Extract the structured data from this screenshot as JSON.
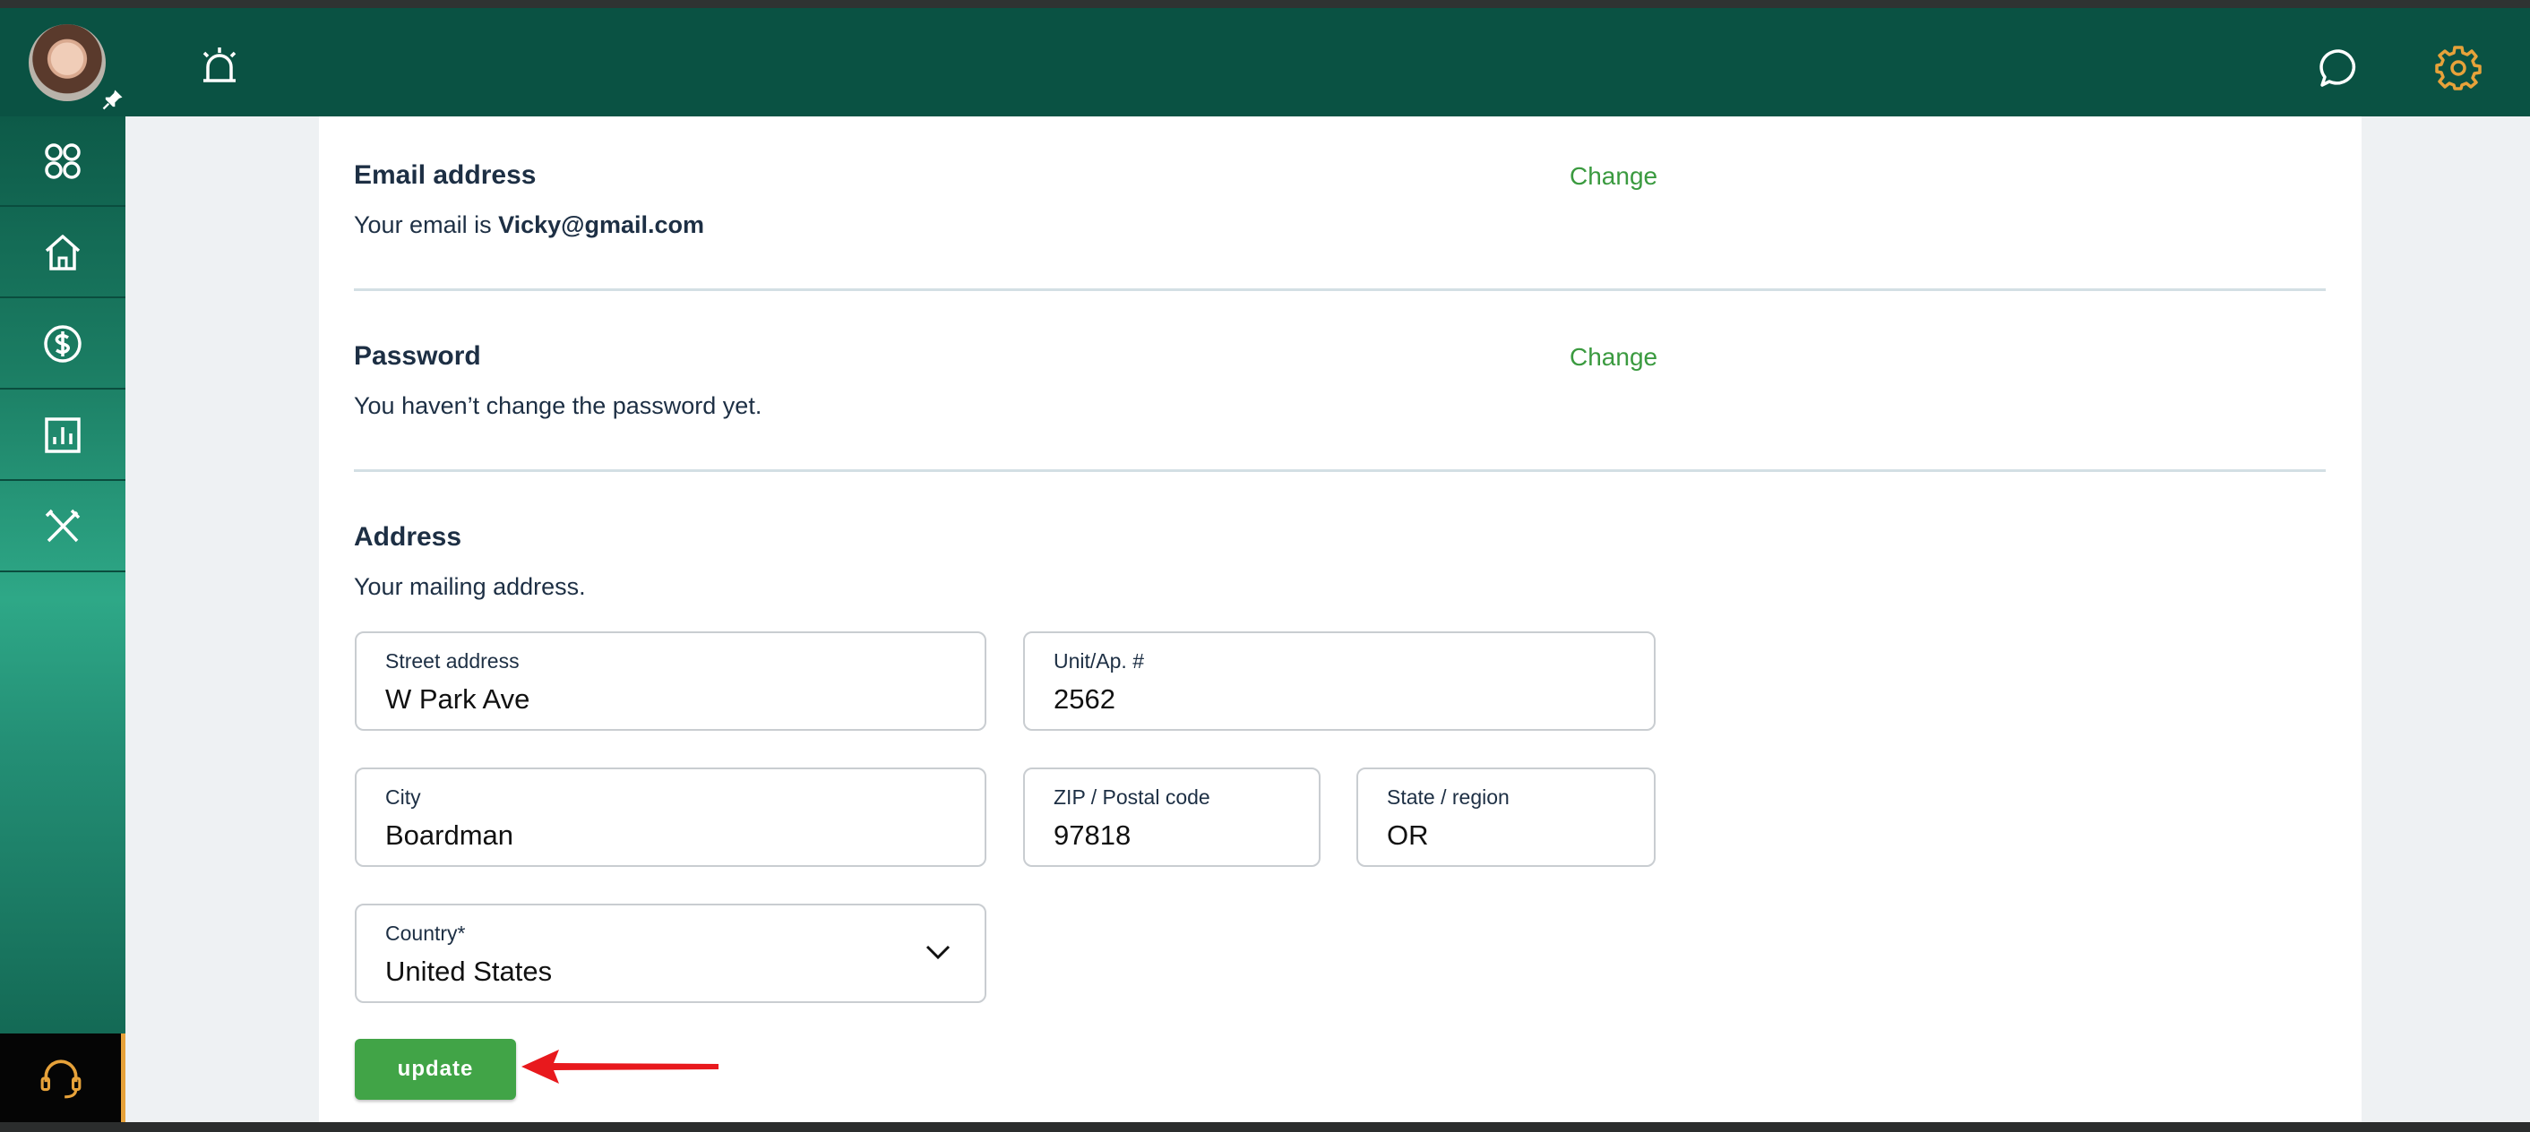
{
  "header": {
    "avatar_alt": "User avatar"
  },
  "sidebar": {
    "items": [
      {
        "name": "apps",
        "icon": "apps-grid-icon"
      },
      {
        "name": "home",
        "icon": "home-icon"
      },
      {
        "name": "payments",
        "icon": "dollar-icon"
      },
      {
        "name": "reports",
        "icon": "bar-chart-icon"
      },
      {
        "name": "tools",
        "icon": "tools-icon"
      }
    ],
    "support_icon": "headset-icon"
  },
  "email": {
    "title": "Email address",
    "prefix": "Your email is ",
    "value": "Vicky@gmail.com",
    "change_label": "Change"
  },
  "password": {
    "title": "Password",
    "text": "You haven’t change the password yet.",
    "change_label": "Change"
  },
  "address": {
    "title": "Address",
    "subtitle": "Your mailing address.",
    "street_label": "Street address",
    "street_value": "W Park Ave",
    "unit_label": "Unit/Ap. #",
    "unit_value": "2562",
    "city_label": "City",
    "city_value": "Boardman",
    "zip_label": "ZIP / Postal code",
    "zip_value": "97818",
    "state_label": "State / region",
    "state_value": "OR",
    "country_label": "Country*",
    "country_value": "United States"
  },
  "actions": {
    "update_label": "update"
  },
  "colors": {
    "header": "#0a5243",
    "accent_green": "#41a447",
    "link_green": "#3a9a3f",
    "gear_orange": "#e7a23a",
    "annotation_red": "#e8191d"
  }
}
